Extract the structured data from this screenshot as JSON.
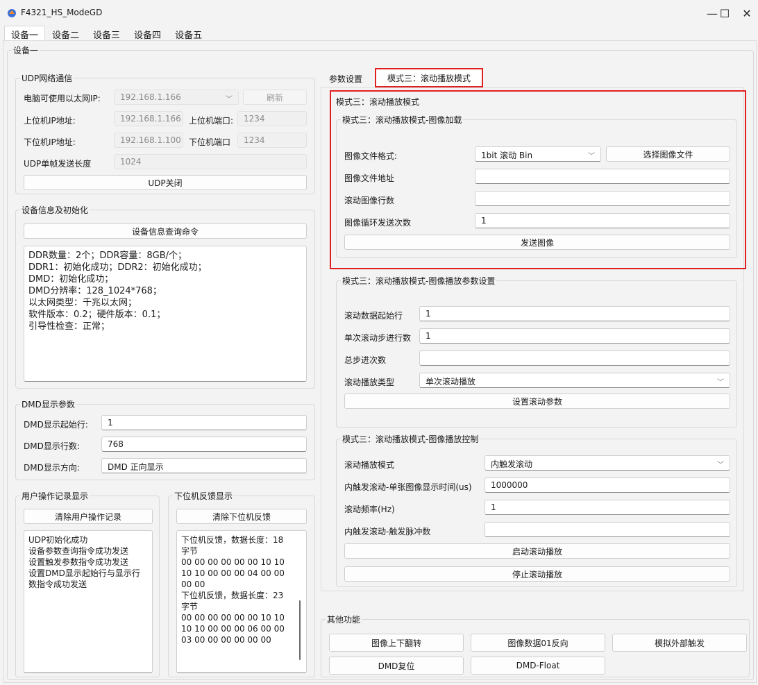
{
  "window": {
    "title": "F4321_HS_ModeGD",
    "minimize": "—",
    "maximize": "☐",
    "close": "✕"
  },
  "device_tabs": [
    "设备一",
    "设备二",
    "设备三",
    "设备四",
    "设备五"
  ],
  "panel_title": "设备一",
  "udp": {
    "group_title": "UDP网络通信",
    "ip_label": "电脑可使用以太网IP:",
    "ip_value": "192.168.1.166",
    "refresh": "刷新",
    "host_ip_label": "上位机IP地址:",
    "host_ip": "192.168.1.166",
    "host_port_label": "上位机端口:",
    "host_port": "1234",
    "dev_ip_label": "下位机IP地址:",
    "dev_ip": "192.168.1.100",
    "dev_port_label": "下位机端口",
    "dev_port": "1234",
    "frame_label": "UDP单帧发送长度",
    "frame_value": "1024",
    "close_button": "UDP关闭"
  },
  "device_info": {
    "group_title": "设备信息及初始化",
    "query_button": "设备信息查询命令",
    "lines": [
      "DDR数量：2个；DDR容量：8GB/个；",
      "DDR1：初始化成功；DDR2：初始化成功；",
      "DMD：初始化成功；",
      "DMD分辨率：128_1024*768；",
      "以太网类型：千兆以太网；",
      "软件版本：0.2；硬件版本：0.1；",
      "引导性检查：正常；"
    ]
  },
  "dmd_params": {
    "group_title": "DMD显示参数",
    "start_label": "DMD显示起始行:",
    "start_value": "1",
    "rows_label": "DMD显示行数:",
    "rows_value": "768",
    "dir_label": "DMD显示方向:",
    "dir_value": "DMD 正向显示"
  },
  "user_log": {
    "group_title": "用户操作记录显示",
    "clear_button": "清除用户操作记录",
    "lines": [
      "UDP初始化成功",
      "设备参数查询指令成功发送",
      "设置触发参数指令成功发送",
      "设置DMD显示起始行与显示行",
      "数指令成功发送"
    ]
  },
  "feedback": {
    "group_title": "下位机反馈显示",
    "clear_button": "清除下位机反馈",
    "lines": [
      "下位机反馈，数据长度：18",
      "字节",
      "00 00 00 00 00 00 10 10",
      "10 10 00 00 00 04 00 00",
      "00 00",
      "下位机反馈，数据长度：23",
      "字节",
      "00 00 00 00 00 00 10 10",
      "10 10 00 00 00 06 00 00",
      "03 00 00 00 00 00 00"
    ]
  },
  "right_tabs": [
    "参数设置",
    "模式三：滚动播放模式"
  ],
  "mode3": {
    "title": "模式三：滚动播放模式",
    "load": {
      "group_title": "模式三：滚动播放模式-图像加载",
      "format_label": "图像文件格式:",
      "format_value": "1bit 滚动 Bin",
      "select_button": "选择图像文件",
      "path_label": "图像文件地址",
      "path_value": "",
      "rows_label": "滚动图像行数",
      "rows_value": "",
      "loop_label": "图像循环发送次数",
      "loop_value": "1",
      "send_button": "发送图像"
    },
    "params": {
      "group_title": "模式三：滚动播放模式-图像播放参数设置",
      "start_label": "滚动数据起始行",
      "start_value": "1",
      "step_label": "单次滚动步进行数",
      "step_value": "1",
      "total_label": "总步进次数",
      "total_value": "",
      "type_label": "滚动播放类型",
      "type_value": "单次滚动播放",
      "set_button": "设置滚动参数"
    },
    "control": {
      "group_title": "模式三：滚动播放模式-图像播放控制",
      "mode_label": "滚动播放模式",
      "mode_value": "内触发滚动",
      "time_label": "内触发滚动-单张图像显示时间(us)",
      "time_value": "1000000",
      "freq_label": "滚动频率(Hz)",
      "freq_value": "1",
      "pulse_label": "内触发滚动-触发脉冲数",
      "pulse_value": "",
      "start_button": "启动滚动播放",
      "stop_button": "停止滚动播放"
    }
  },
  "other": {
    "group_title": "其他功能",
    "flip_button": "图像上下翻转",
    "invert_button": "图像数据01反向",
    "trigger_button": "模拟外部触发",
    "reset_button": "DMD复位",
    "float_button": "DMD-Float"
  },
  "colors": {
    "highlight": "#e02020",
    "background": "#f3f3f3"
  }
}
